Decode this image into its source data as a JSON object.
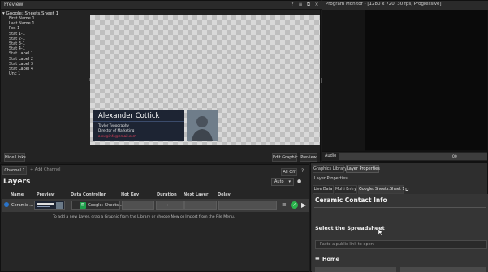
{
  "preview": {
    "title": "Preview",
    "header_icons": [
      "?",
      "≡",
      "⧉",
      "×"
    ],
    "tree_root": "Google: Sheets.Sheet 1",
    "tree_items": [
      "First Name 1",
      "Last Name 1",
      "Pos 1",
      "Stat 1-1",
      "Stat 2-1",
      "Stat 3-1",
      "Stat 4-1",
      "Stat Label 1",
      "Stat Label 2",
      "Stat Label 3",
      "Stat Label 4",
      "Unc 1"
    ],
    "lower_third": {
      "name": "Alexander Cottick",
      "line1": "Taylor Typography",
      "line2": "Director of Marketing",
      "email": "alex@info@email.com"
    },
    "hide_links": "Hide Links",
    "edit_graphic": "Edit Graphic",
    "preview_button": "Preview"
  },
  "program": {
    "title": "Program Monitor - [1280 x 720, 30 fps, Progressive]"
  },
  "audio": {
    "label": "Audio",
    "value": "00"
  },
  "layers": {
    "channel_tab": "Channel 1",
    "add_channel": "+ Add Channel",
    "all_off": "All Off",
    "help": "?",
    "title": "Layers",
    "auto": "Auto",
    "columns": [
      "Name",
      "Preview",
      "Data Controller",
      "Hot Key",
      "Duration",
      "Next Layer",
      "Delay"
    ],
    "row": {
      "name": "Ceramic ...",
      "data_controller": "Google: Sheets...",
      "duration": "-- : -- : --",
      "next_layer": "-------"
    },
    "empty_message": "To add a new Layer, drag a Graphic from the Library or choose New or Import from the File Menu."
  },
  "right_panel": {
    "tabs": [
      "Graphics Library",
      "Layer Properties"
    ],
    "layer_properties_label": "Layer Properties",
    "sub_tabs": [
      "Live Data",
      "Multi Entry",
      "Google: Sheets.Sheet 1"
    ],
    "heading": "Ceramic Contact Info",
    "select_spreadsheet": "Select the Spreadsheet",
    "link_placeholder": "Paste a public link to open",
    "home": "Home"
  }
}
